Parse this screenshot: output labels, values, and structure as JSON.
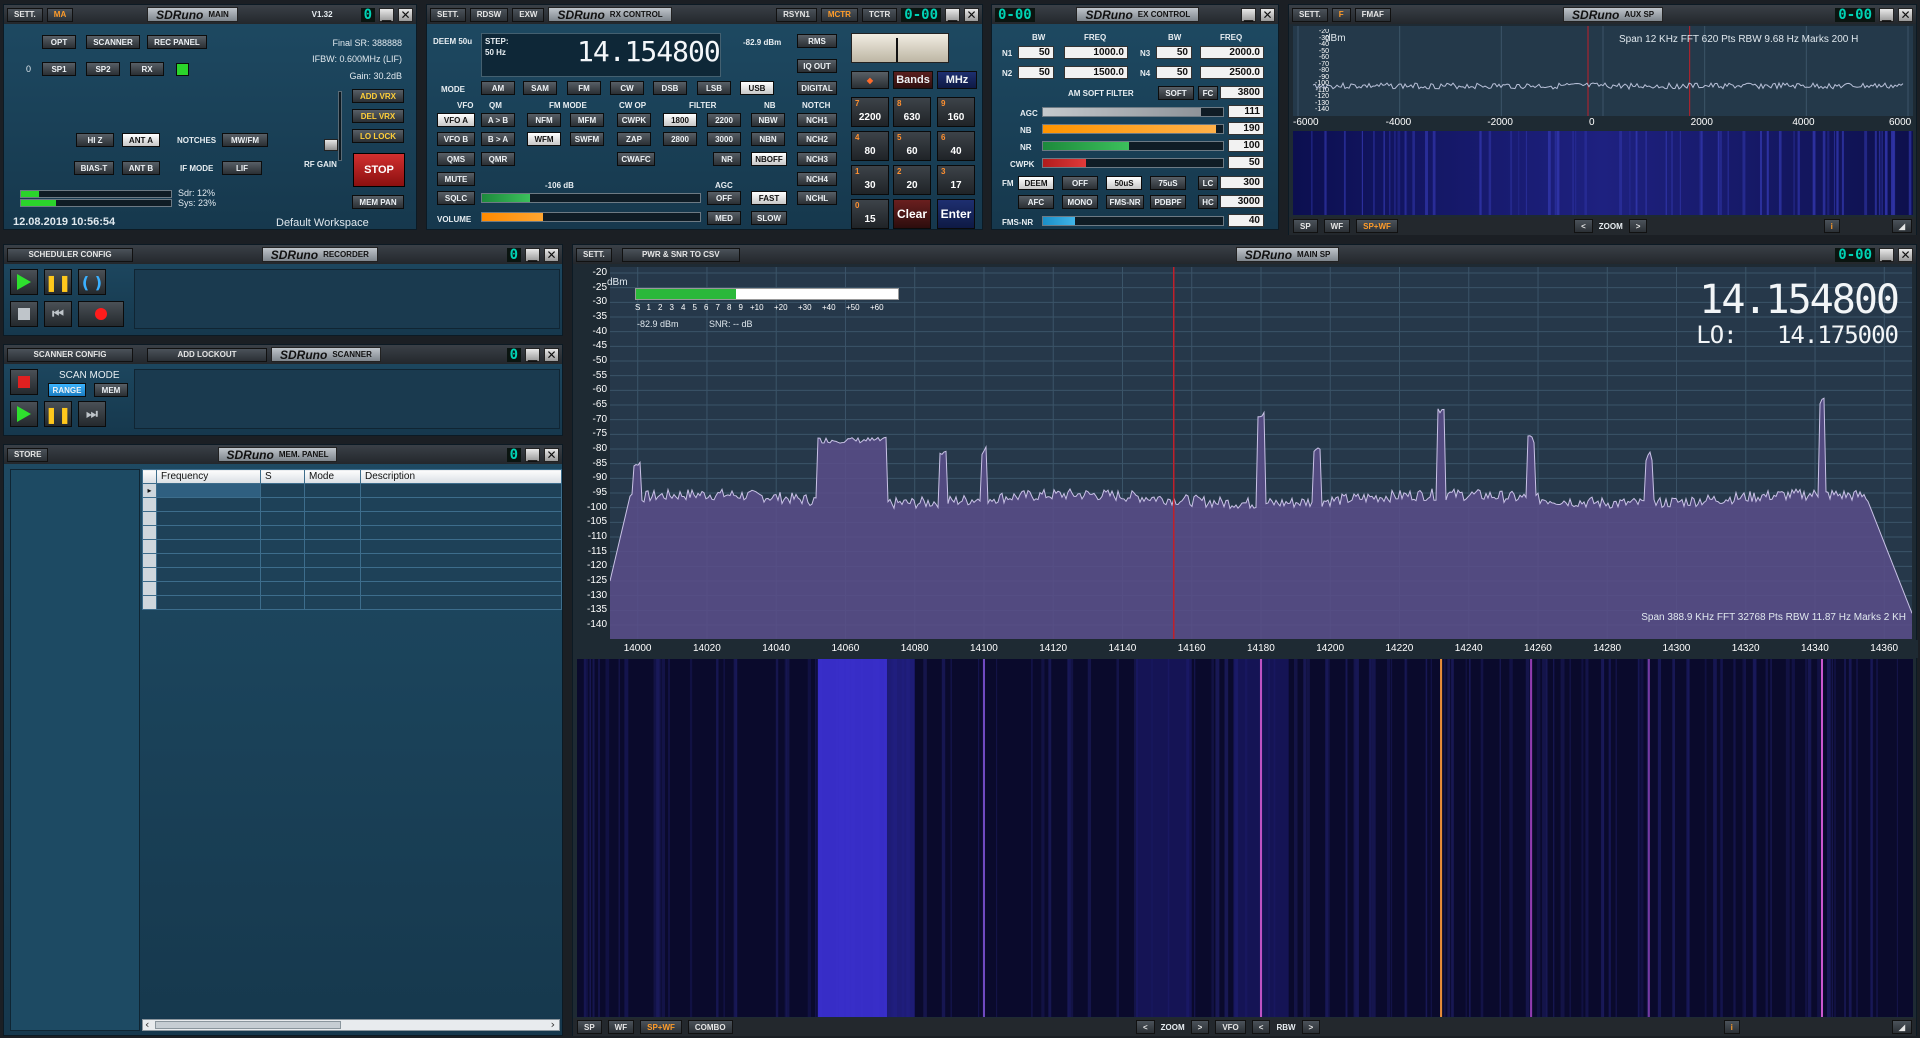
{
  "main": {
    "sett": "SETT.",
    "ma": "MA",
    "logo": "SDRuno",
    "title": "MAIN",
    "version": "V1.32",
    "digit": "0",
    "opt": "OPT",
    "scanner": "SCANNER",
    "rec_panel": "REC PANEL",
    "sp_index": "0",
    "sp1": "SP1",
    "sp2": "SP2",
    "rx": "RX",
    "final_sr": "Final SR: 388888",
    "ifbw": "IFBW: 0.600MHz (LIF)",
    "gain": "Gain: 30.2dB",
    "add_vrx": "ADD VRX",
    "del_vrx": "DEL VRX",
    "lo_lock": "LO LOCK",
    "hi_z": "HI Z",
    "ant_a": "ANT A",
    "notches": "NOTCHES",
    "mw_fm": "MW/FM",
    "bias_t": "BIAS-T",
    "ant_b": "ANT B",
    "if_mode": "IF MODE",
    "lif": "LIF",
    "rf_gain": "RF GAIN",
    "stop": "STOP",
    "mem_pan": "MEM PAN",
    "sdr_load": "Sdr: 12%",
    "sys_load": "Sys: 23%",
    "sdr_pct": 12,
    "sys_pct": 23,
    "datetime": "12.08.2019 10:56:54",
    "workspace": "Default Workspace"
  },
  "rx": {
    "sett": "SETT.",
    "rdsw": "RDSW",
    "exw": "EXW",
    "logo": "SDRuno",
    "title": "RX CONTROL",
    "rsyn": "RSYN1",
    "mctr": "MCTR",
    "tctr": "TCTR",
    "digit": "0-00",
    "deem": "DEEM 50u",
    "step_label": "STEP:",
    "step_value": "50 Hz",
    "freq": "14.154800",
    "level": "-82.9 dBm",
    "rms": "RMS",
    "iq_out": "IQ OUT",
    "mode": "MODE",
    "modes": [
      "AM",
      "SAM",
      "FM",
      "CW",
      "DSB",
      "LSB",
      "USB",
      "DIGITAL"
    ],
    "vfo": "VFO",
    "qm": "QM",
    "fm_mode": "FM MODE",
    "cw_op": "CW OP",
    "filter": "FILTER",
    "nb": "NB",
    "notch": "NOTCH",
    "vfo_a": "VFO A",
    "a_to_b": "A > B",
    "nfm": "NFM",
    "mfm": "MFM",
    "cwpk": "CWPK",
    "f1800": "1800",
    "f2200": "2200",
    "nbw": "NBW",
    "nch1": "NCH1",
    "vfo_b": "VFO B",
    "b_to_a": "B > A",
    "wfm": "WFM",
    "swfm": "SWFM",
    "zap": "ZAP",
    "f2800": "2800",
    "f3000": "3000",
    "nbn": "NBN",
    "nch2": "NCH2",
    "qms": "QMS",
    "qmr": "QMR",
    "cwafc": "CWAFC",
    "nr": "NR",
    "nboff": "NBOFF",
    "nch3": "NCH3",
    "mute": "MUTE",
    "sq_level": "-106 dB",
    "agc": "AGC",
    "nch4": "NCH4",
    "sqlc": "SQLC",
    "off": "OFF",
    "fast": "FAST",
    "nchl": "NCHL",
    "volume": "VOLUME",
    "med": "MED",
    "slow": "SLOW",
    "volume_pct": 28,
    "sq_pct": 22,
    "bands": "Bands",
    "mhz": "MHz",
    "keys": [
      {
        "n": "7",
        "v": "2200"
      },
      {
        "n": "8",
        "v": "630"
      },
      {
        "n": "9",
        "v": "160"
      },
      {
        "n": "4",
        "v": "80"
      },
      {
        "n": "5",
        "v": "60"
      },
      {
        "n": "6",
        "v": "40"
      },
      {
        "n": "1",
        "v": "30"
      },
      {
        "n": "2",
        "v": "20"
      },
      {
        "n": "3",
        "v": "17"
      }
    ],
    "k0n": "0",
    "k0": "15",
    "clear": "Clear",
    "enter": "Enter"
  },
  "ex": {
    "digit": "0-00",
    "logo": "SDRuno",
    "title": "EX CONTROL",
    "bw": "BW",
    "freq": "FREQ",
    "n1": "N1",
    "n1_bw": "50",
    "n1_freq": "1000.0",
    "n3": "N3",
    "n3_bw": "50",
    "n3_freq": "2000.0",
    "n2": "N2",
    "n2_bw": "50",
    "n2_freq": "1500.0",
    "n4": "N4",
    "n4_bw": "50",
    "n4_freq": "2500.0",
    "am_soft": "AM SOFT FILTER",
    "soft": "SOFT",
    "fc": "FC",
    "fc_value": "3800",
    "agc": "AGC",
    "agc_value": "111",
    "agc_pct": 88,
    "nb": "NB",
    "nb_value": "190",
    "nb_pct": 96,
    "nr": "NR",
    "nr_value": "100",
    "nr_pct": 48,
    "cwpk": "CWPK",
    "cwpk_value": "50",
    "cwpk_pct": 24,
    "fm": "FM",
    "deem": "DEEM",
    "off": "OFF",
    "u50": "50uS",
    "u75": "75uS",
    "lc": "LC",
    "lc_value": "300",
    "afc": "AFC",
    "mono": "MONO",
    "fms_nr": "FMS-NR",
    "pdbpf": "PDBPF",
    "hc": "HC",
    "hc_value": "3000",
    "fms_nr_label": "FMS-NR",
    "fms_nr_value": "40",
    "fms_nr_pct": 18
  },
  "aux": {
    "sett": "SETT.",
    "f": "F",
    "fmaf": "FMAF",
    "logo": "SDRuno",
    "title": "AUX SP",
    "digit": "0-00",
    "dbm": "dBm",
    "info": "Span 12 KHz  FFT 620 Pts  RBW 9.68 Hz  Marks 200 H",
    "y_ticks": [
      "-20",
      "-30",
      "-40",
      "-50",
      "-60",
      "-70",
      "-80",
      "-90",
      "-100",
      "-110",
      "-120",
      "-130",
      "-140"
    ],
    "x_ticks": [
      "-6000",
      "-4000",
      "-2000",
      "0",
      "2000",
      "4000",
      "6000"
    ],
    "sp": "SP",
    "wf": "WF",
    "spwf": "SP+WF",
    "zoom": "ZOOM",
    "i": "i"
  },
  "sched": {
    "config": "SCHEDULER CONFIG",
    "logo": "SDRuno",
    "title": "RECORDER",
    "digit": "0"
  },
  "scanner": {
    "config": "SCANNER CONFIG",
    "add_lockout": "ADD LOCKOUT",
    "logo": "SDRuno",
    "title": "SCANNER",
    "digit": "0",
    "scan_mode": "SCAN MODE",
    "range": "RANGE",
    "mem": "MEM"
  },
  "mem": {
    "logo": "SDRuno",
    "title": "MEM. PANEL",
    "digit": "0",
    "store": "STORE",
    "cols": [
      "Frequency",
      "S",
      "Mode",
      "Description"
    ]
  },
  "mainsp": {
    "sett": "SETT.",
    "csv": "PWR & SNR TO CSV",
    "logo": "SDRuno",
    "title": "MAIN SP",
    "digit": "0-00",
    "dbm": "dBm",
    "smeter_ticks": [
      "S",
      "1",
      "2",
      "3",
      "4",
      "5",
      "6",
      "7",
      "8",
      "9",
      "+10",
      "+20",
      "+30",
      "+40",
      "+50",
      "+60"
    ],
    "level": "-82.9 dBm",
    "snr": "SNR: -- dB",
    "smeter_pct": 38,
    "freq": "14.154800",
    "lo": "LO:   14.175000",
    "y_ticks": [
      "-20",
      "-25",
      "-30",
      "-35",
      "-40",
      "-45",
      "-50",
      "-55",
      "-60",
      "-65",
      "-70",
      "-75",
      "-80",
      "-85",
      "-90",
      "-95",
      "-100",
      "-105",
      "-110",
      "-115",
      "-120",
      "-125",
      "-130",
      "-135",
      "-140"
    ],
    "x_ticks": [
      "14000",
      "14020",
      "14040",
      "14060",
      "14080",
      "14100",
      "14120",
      "14140",
      "14160",
      "14180",
      "14200",
      "14220",
      "14240",
      "14260",
      "14280",
      "14300",
      "14320",
      "14340",
      "14360"
    ],
    "info": "Span 388.9 KHz  FFT 32768 Pts  RBW 11.87 Hz  Marks 2 KH",
    "sp": "SP",
    "wf": "WF",
    "spwf": "SP+WF",
    "combo": "COMBO",
    "zoom": "ZOOM",
    "vfo": "VFO",
    "rbw": "RBW",
    "i": "i"
  },
  "colors": {
    "accent": "#ff9c2a",
    "digit": "#00d2b4",
    "spectrum_fill": "#5a4d8a",
    "marker": "#c0202a",
    "waterfall_bg": "#0a0a2c"
  }
}
